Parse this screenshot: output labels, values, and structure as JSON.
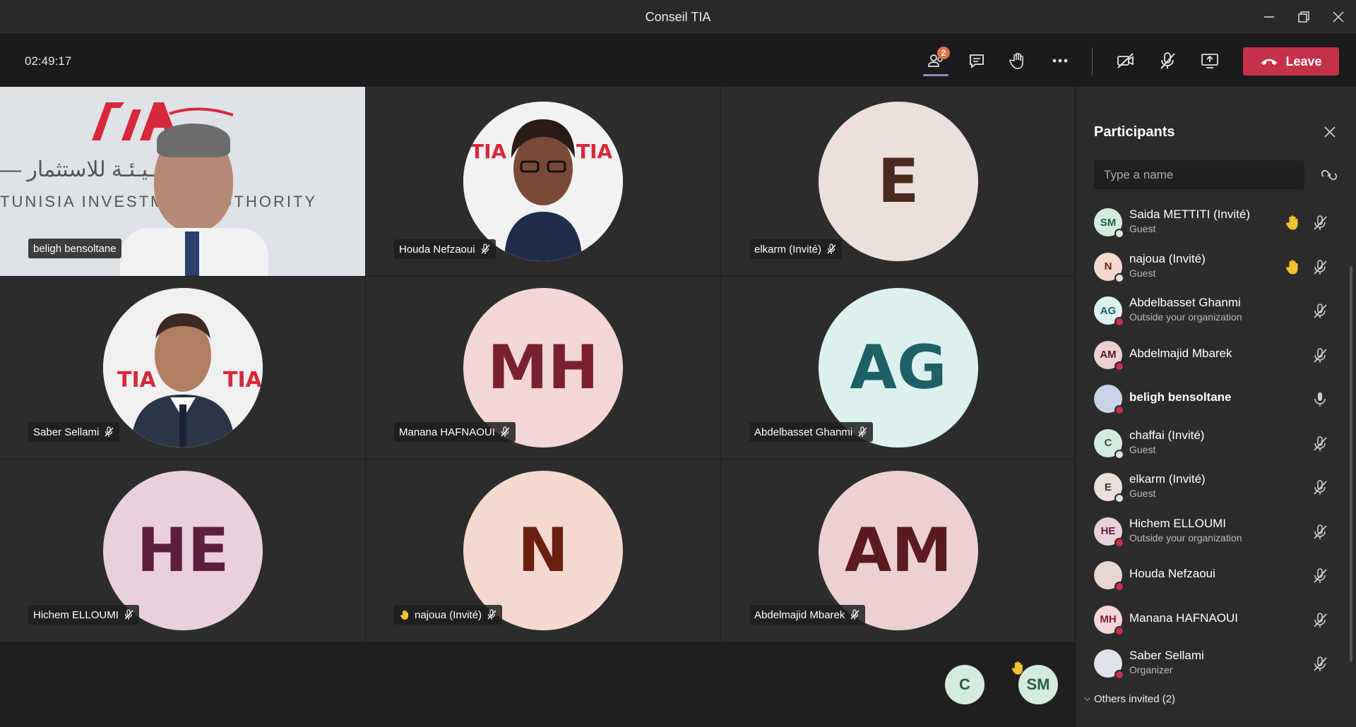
{
  "window": {
    "title": "Conseil TIA"
  },
  "toolbar": {
    "timer": "02:49:17",
    "participants_badge": "2",
    "leave_label": "Leave"
  },
  "tiles": [
    {
      "name": "beligh bensoltane",
      "type": "video",
      "muted": false,
      "hand": false
    },
    {
      "name": "Houda Nefzaoui",
      "type": "photo",
      "muted": true,
      "hand": false
    },
    {
      "name": "elkarm (Invité)",
      "type": "initials",
      "initials": "E",
      "bg": "#ece0dc",
      "fg": "#4a2a1f",
      "muted": true,
      "hand": false
    },
    {
      "name": "Saber Sellami",
      "type": "photo",
      "muted": true,
      "hand": false
    },
    {
      "name": "Manana HAFNAOUI",
      "type": "initials",
      "initials": "MH",
      "bg": "#f3d6d6",
      "fg": "#7a2130",
      "muted": true,
      "hand": false
    },
    {
      "name": "Abdelbasset Ghanmi",
      "type": "initials",
      "initials": "AG",
      "bg": "#dcf0f0",
      "fg": "#1d6165",
      "muted": true,
      "hand": false
    },
    {
      "name": "Hichem ELLOUMI",
      "type": "initials",
      "initials": "HE",
      "bg": "#ead0dd",
      "fg": "#5e1f3d",
      "muted": true,
      "hand": false
    },
    {
      "name": "najoua (Invité)",
      "type": "initials",
      "initials": "N",
      "bg": "#f4d9cf",
      "fg": "#6b1f10",
      "muted": true,
      "hand": true
    },
    {
      "name": "Abdelmajid Mbarek",
      "type": "initials",
      "initials": "AM",
      "bg": "#ecd1d3",
      "fg": "#5a1a1f",
      "muted": true,
      "hand": false
    }
  ],
  "overflow": [
    {
      "initials": "C",
      "bg": "#d4ecdf",
      "fg": "#2a5d43",
      "hand": false
    },
    {
      "initials": "SM",
      "bg": "#d4ecdf",
      "fg": "#2a5d43",
      "hand": true
    }
  ],
  "panel": {
    "title": "Participants",
    "search_placeholder": "Type a name",
    "participants": [
      {
        "initials": "SM",
        "name": "Saida METTITI (Invité)",
        "sub": "Guest",
        "bg": "#d4ecdf",
        "fg": "#2a5d43",
        "status": "#e0e0e0",
        "hand": true,
        "mic": "muted"
      },
      {
        "initials": "N",
        "name": "najoua (Invité)",
        "sub": "Guest",
        "bg": "#f4d9cf",
        "fg": "#6b1f10",
        "status": "#e0e0e0",
        "hand": true,
        "mic": "muted"
      },
      {
        "initials": "AG",
        "name": "Abdelbasset Ghanmi",
        "sub": "Outside your organization",
        "bg": "#dcf0f0",
        "fg": "#1d6165",
        "status": "#c4314b",
        "hand": false,
        "mic": "muted"
      },
      {
        "initials": "AM",
        "name": "Abdelmajid Mbarek",
        "sub": "",
        "bg": "#ecd1d3",
        "fg": "#5a1a1f",
        "status": "#c4314b",
        "hand": false,
        "mic": "muted"
      },
      {
        "initials": "",
        "name": "beligh bensoltane",
        "sub": "",
        "bg": "#c9d3e8",
        "fg": "#333",
        "status": "#c4314b",
        "hand": false,
        "mic": "on",
        "bold": true
      },
      {
        "initials": "C",
        "name": "chaffai (Invité)",
        "sub": "Guest",
        "bg": "#d4ecdf",
        "fg": "#2a5d43",
        "status": "#e0e0e0",
        "hand": false,
        "mic": "muted"
      },
      {
        "initials": "E",
        "name": "elkarm (Invité)",
        "sub": "Guest",
        "bg": "#ece0dc",
        "fg": "#4a2a1f",
        "status": "#e0e0e0",
        "hand": false,
        "mic": "muted"
      },
      {
        "initials": "HE",
        "name": "Hichem ELLOUMI",
        "sub": "Outside your organization",
        "bg": "#ead0dd",
        "fg": "#5e1f3d",
        "status": "#c4314b",
        "hand": false,
        "mic": "muted"
      },
      {
        "initials": "",
        "name": "Houda Nefzaoui",
        "sub": "",
        "bg": "#e8d6d0",
        "fg": "#333",
        "status": "#c4314b",
        "hand": false,
        "mic": "muted"
      },
      {
        "initials": "MH",
        "name": "Manana HAFNAOUI",
        "sub": "",
        "bg": "#f3d6d6",
        "fg": "#7a2130",
        "status": "#c4314b",
        "hand": false,
        "mic": "muted"
      },
      {
        "initials": "",
        "name": "Saber Sellami",
        "sub": "Organizer",
        "bg": "#dfe3ea",
        "fg": "#333",
        "status": "#c4314b",
        "hand": false,
        "mic": "muted"
      }
    ],
    "others_invited": "Others invited (2)"
  }
}
